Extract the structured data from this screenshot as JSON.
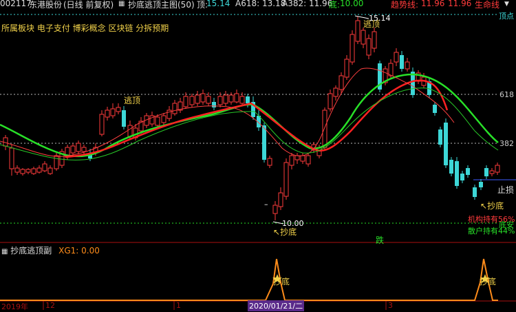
{
  "top_bar": {
    "code": "002117",
    "name": "东港股份",
    "period": "(日线 前复权)",
    "icon": "grid-icon",
    "indicator_title": "抄底逃顶主图(50)",
    "top_label": "顶:",
    "top_value": "15.14",
    "a618": "A618: 13.18",
    "a382": "A382: 11.96",
    "bottom_label": "底:",
    "bottom_value": "10.00",
    "trend_label": "趋势线:",
    "trend_v1": "11.96",
    "trend_v2": "11.96",
    "life_label": "生命线"
  },
  "concept_text": "所属板块 电子支付 博彩概念 区块链 分拆预期",
  "levels": {
    "top": "顶点",
    "l618": "618",
    "l382": "382",
    "stop": "止损",
    "bottom": "底安"
  },
  "signals": {
    "escape1": "逃顶",
    "escape2": "逃顶",
    "bottom1": "抄底",
    "bottom2": "抄底",
    "high_price": "15.14",
    "low_price": "10.00",
    "fall": "跌",
    "minus": "–"
  },
  "holdings": {
    "institution": "机构持有56%",
    "retail": "散户持有44%"
  },
  "sub_panel": {
    "icon": "grid-icon",
    "title": "抄底逃顶副",
    "xg_label": "XG1: 0.00",
    "sig1": "抄底",
    "sig2": "抄底"
  },
  "axis": {
    "t1": "2019年",
    "t2": "12",
    "t3": "1",
    "cursor_date": "2020/01/21/二",
    "t4": "3"
  },
  "colors": {
    "up": "#ff3b3b",
    "down": "#3dd7d7",
    "green": "#28e028",
    "yellow": "#f2d24a",
    "orange": "#ff8c1a"
  }
}
